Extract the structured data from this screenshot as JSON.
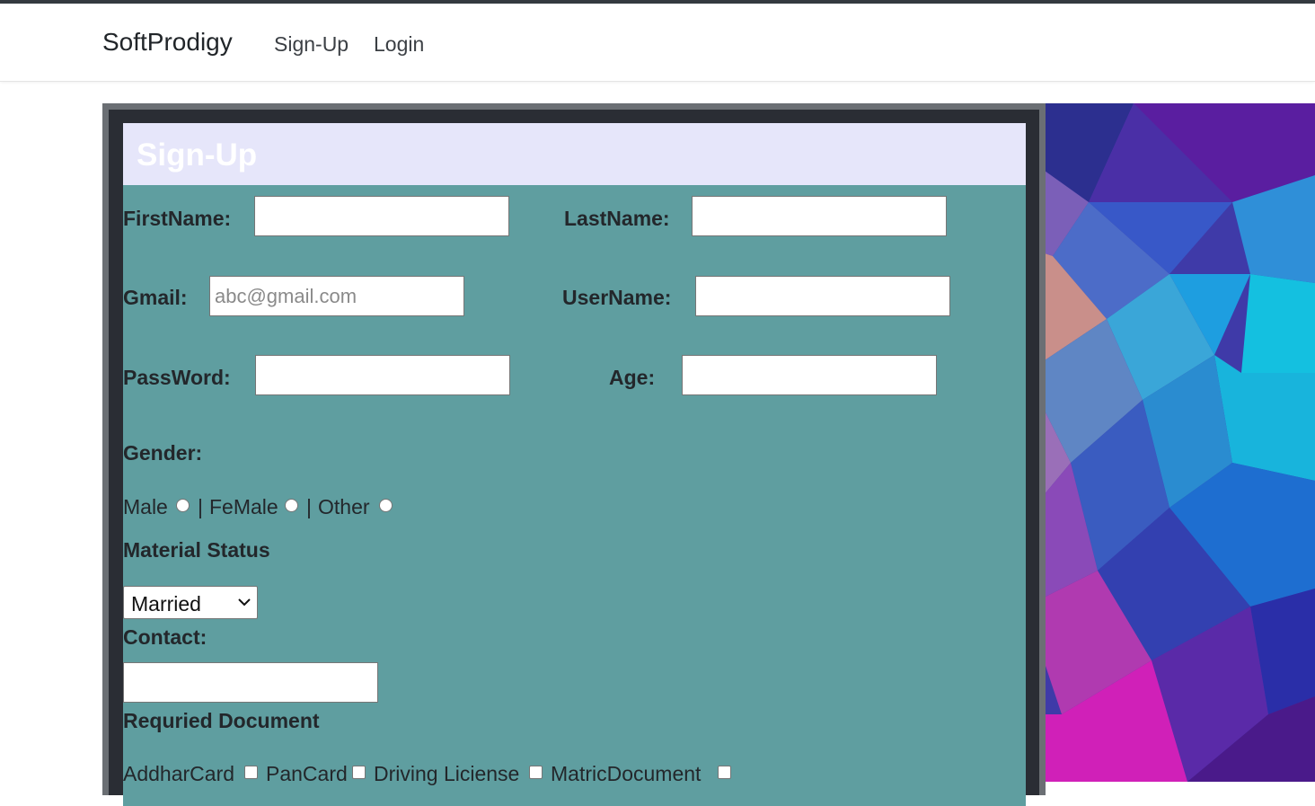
{
  "navbar": {
    "brand": "SoftProdigy",
    "links": [
      {
        "label": "Sign-Up"
      },
      {
        "label": "Login"
      }
    ]
  },
  "form": {
    "title": "Sign-Up",
    "firstname_label": "FirstName:",
    "firstname_value": "",
    "lastname_label": "LastName:",
    "lastname_value": "",
    "gmail_label": "Gmail:",
    "gmail_placeholder": "abc@gmail.com",
    "username_label": "UserName:",
    "username_value": "",
    "password_label": "PassWord:",
    "age_label": "Age:",
    "gender_label": "Gender:",
    "gender_options": [
      "Male",
      "FeMale",
      "Other"
    ],
    "separator": "|",
    "marital_label": "Material Status",
    "marital_selected": "Married",
    "contact_label": "Contact:",
    "documents_label": "Requried Document",
    "documents": [
      "AddharCard",
      "PanCard",
      "Driving Liciense",
      "MatricDocument"
    ]
  },
  "colors": {
    "card_bg": "#5f9ea0",
    "header_bg": "#e6e6fa",
    "frame": "#6b6f74"
  }
}
